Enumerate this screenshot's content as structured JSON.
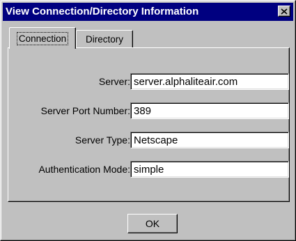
{
  "window": {
    "title": "View Connection/Directory Information"
  },
  "tabs": [
    {
      "label": "Connection",
      "active": true
    },
    {
      "label": "Directory",
      "active": false
    }
  ],
  "fields": [
    {
      "label": "Server:",
      "value": "server.alphaliteair.com"
    },
    {
      "label": "Server Port Number:",
      "value": "389"
    },
    {
      "label": "Server Type:",
      "value": "Netscape"
    },
    {
      "label": "Authentication Mode:",
      "value": "simple"
    }
  ],
  "buttons": {
    "ok_label": "OK"
  },
  "icons": {
    "close": "close-icon"
  },
  "colors": {
    "titlebar": "#000080",
    "face": "#c0c0c0",
    "field_bg": "#ffffff"
  }
}
